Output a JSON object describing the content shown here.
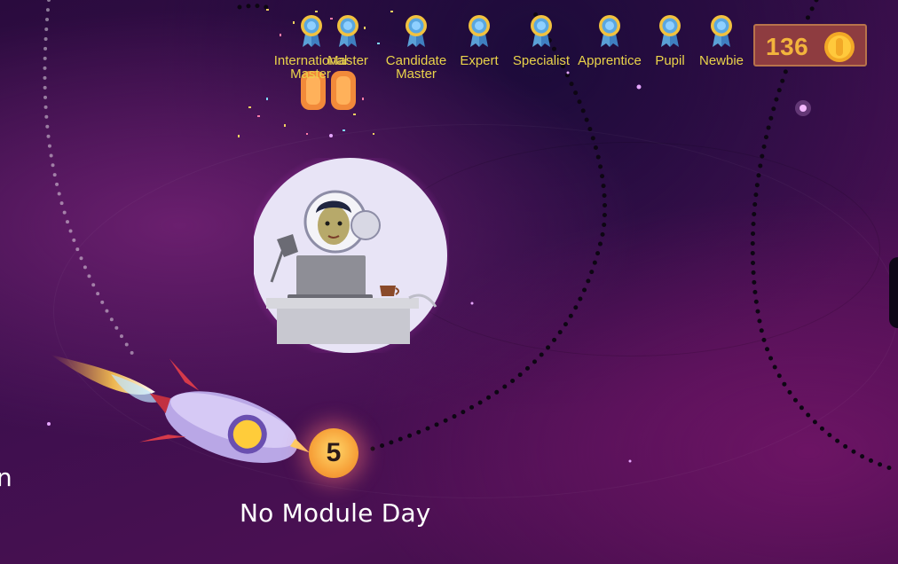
{
  "badges": [
    {
      "label": "International Master"
    },
    {
      "label": "Master"
    },
    {
      "label": "Candidate Master"
    },
    {
      "label": "Expert"
    },
    {
      "label": "Specialist"
    },
    {
      "label": "Apprentice"
    },
    {
      "label": "Pupil"
    },
    {
      "label": "Newbie"
    }
  ],
  "coins": {
    "count": "136"
  },
  "module": {
    "number": "5",
    "label": "No Module Day"
  },
  "edge_text": "n",
  "colors": {
    "badge_label": "#ead34a",
    "coin_box": "#8e3c40",
    "coin_text": "#f3b43c",
    "node": "#f7a23a"
  },
  "icons": [
    "medal-icon",
    "coin-icon",
    "rocket-icon",
    "astronaut-avatar"
  ]
}
